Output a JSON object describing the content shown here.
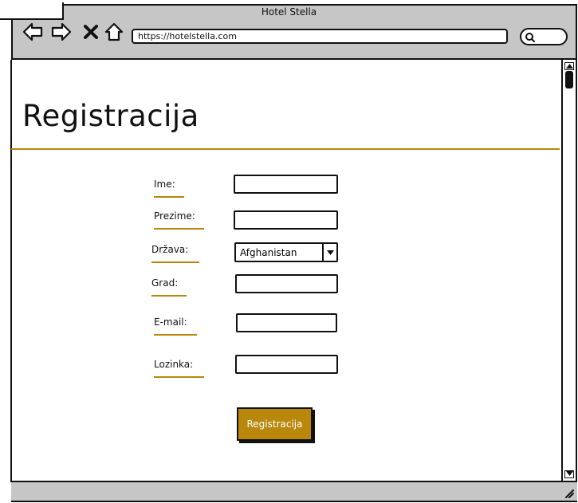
{
  "browser": {
    "window_title": "Hotel Stella",
    "url": "https://hotelstella.com",
    "back_icon": "arrow-left-icon",
    "forward_icon": "arrow-right-icon",
    "stop_icon": "close-icon",
    "home_icon": "home-icon",
    "search_icon": "search-icon"
  },
  "page": {
    "title": "Registracija",
    "accent_color": "#b8870b"
  },
  "form": {
    "fields": [
      {
        "label": "Ime:",
        "value": ""
      },
      {
        "label": "Prezime:",
        "value": ""
      },
      {
        "label": "Država:",
        "value": "Afghanistan"
      },
      {
        "label": "Grad:",
        "value": ""
      },
      {
        "label": "E-mail:",
        "value": ""
      },
      {
        "label": "Lozinka:",
        "value": ""
      }
    ],
    "submit_label": "Registracija"
  }
}
